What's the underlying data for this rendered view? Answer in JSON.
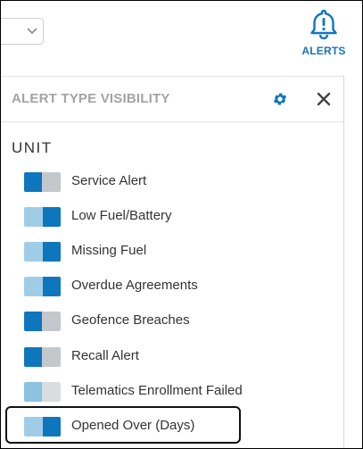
{
  "header": {
    "alerts_label": "ALERTS"
  },
  "panel": {
    "title": "ALERT TYPE VISIBILITY",
    "section_title": "UNIT",
    "items": [
      {
        "label": "Service Alert",
        "state": "off"
      },
      {
        "label": "Low Fuel/Battery",
        "state": "on"
      },
      {
        "label": "Missing Fuel",
        "state": "on"
      },
      {
        "label": "Overdue Agreements",
        "state": "on"
      },
      {
        "label": "Geofence Breaches",
        "state": "off"
      },
      {
        "label": "Recall Alert",
        "state": "off"
      },
      {
        "label": "Telematics Enrollment Failed",
        "state": "disabled"
      },
      {
        "label": "Opened Over (Days)",
        "state": "on"
      }
    ]
  },
  "colors": {
    "accent": "#0e76bd",
    "toggle_on_track": "#9fcde8",
    "toggle_off_track": "#c4c8cc"
  },
  "icons": {
    "alerts": "bell-icon",
    "settings": "gear-icon",
    "close": "close-icon",
    "dropdown": "chevron-down-icon"
  }
}
